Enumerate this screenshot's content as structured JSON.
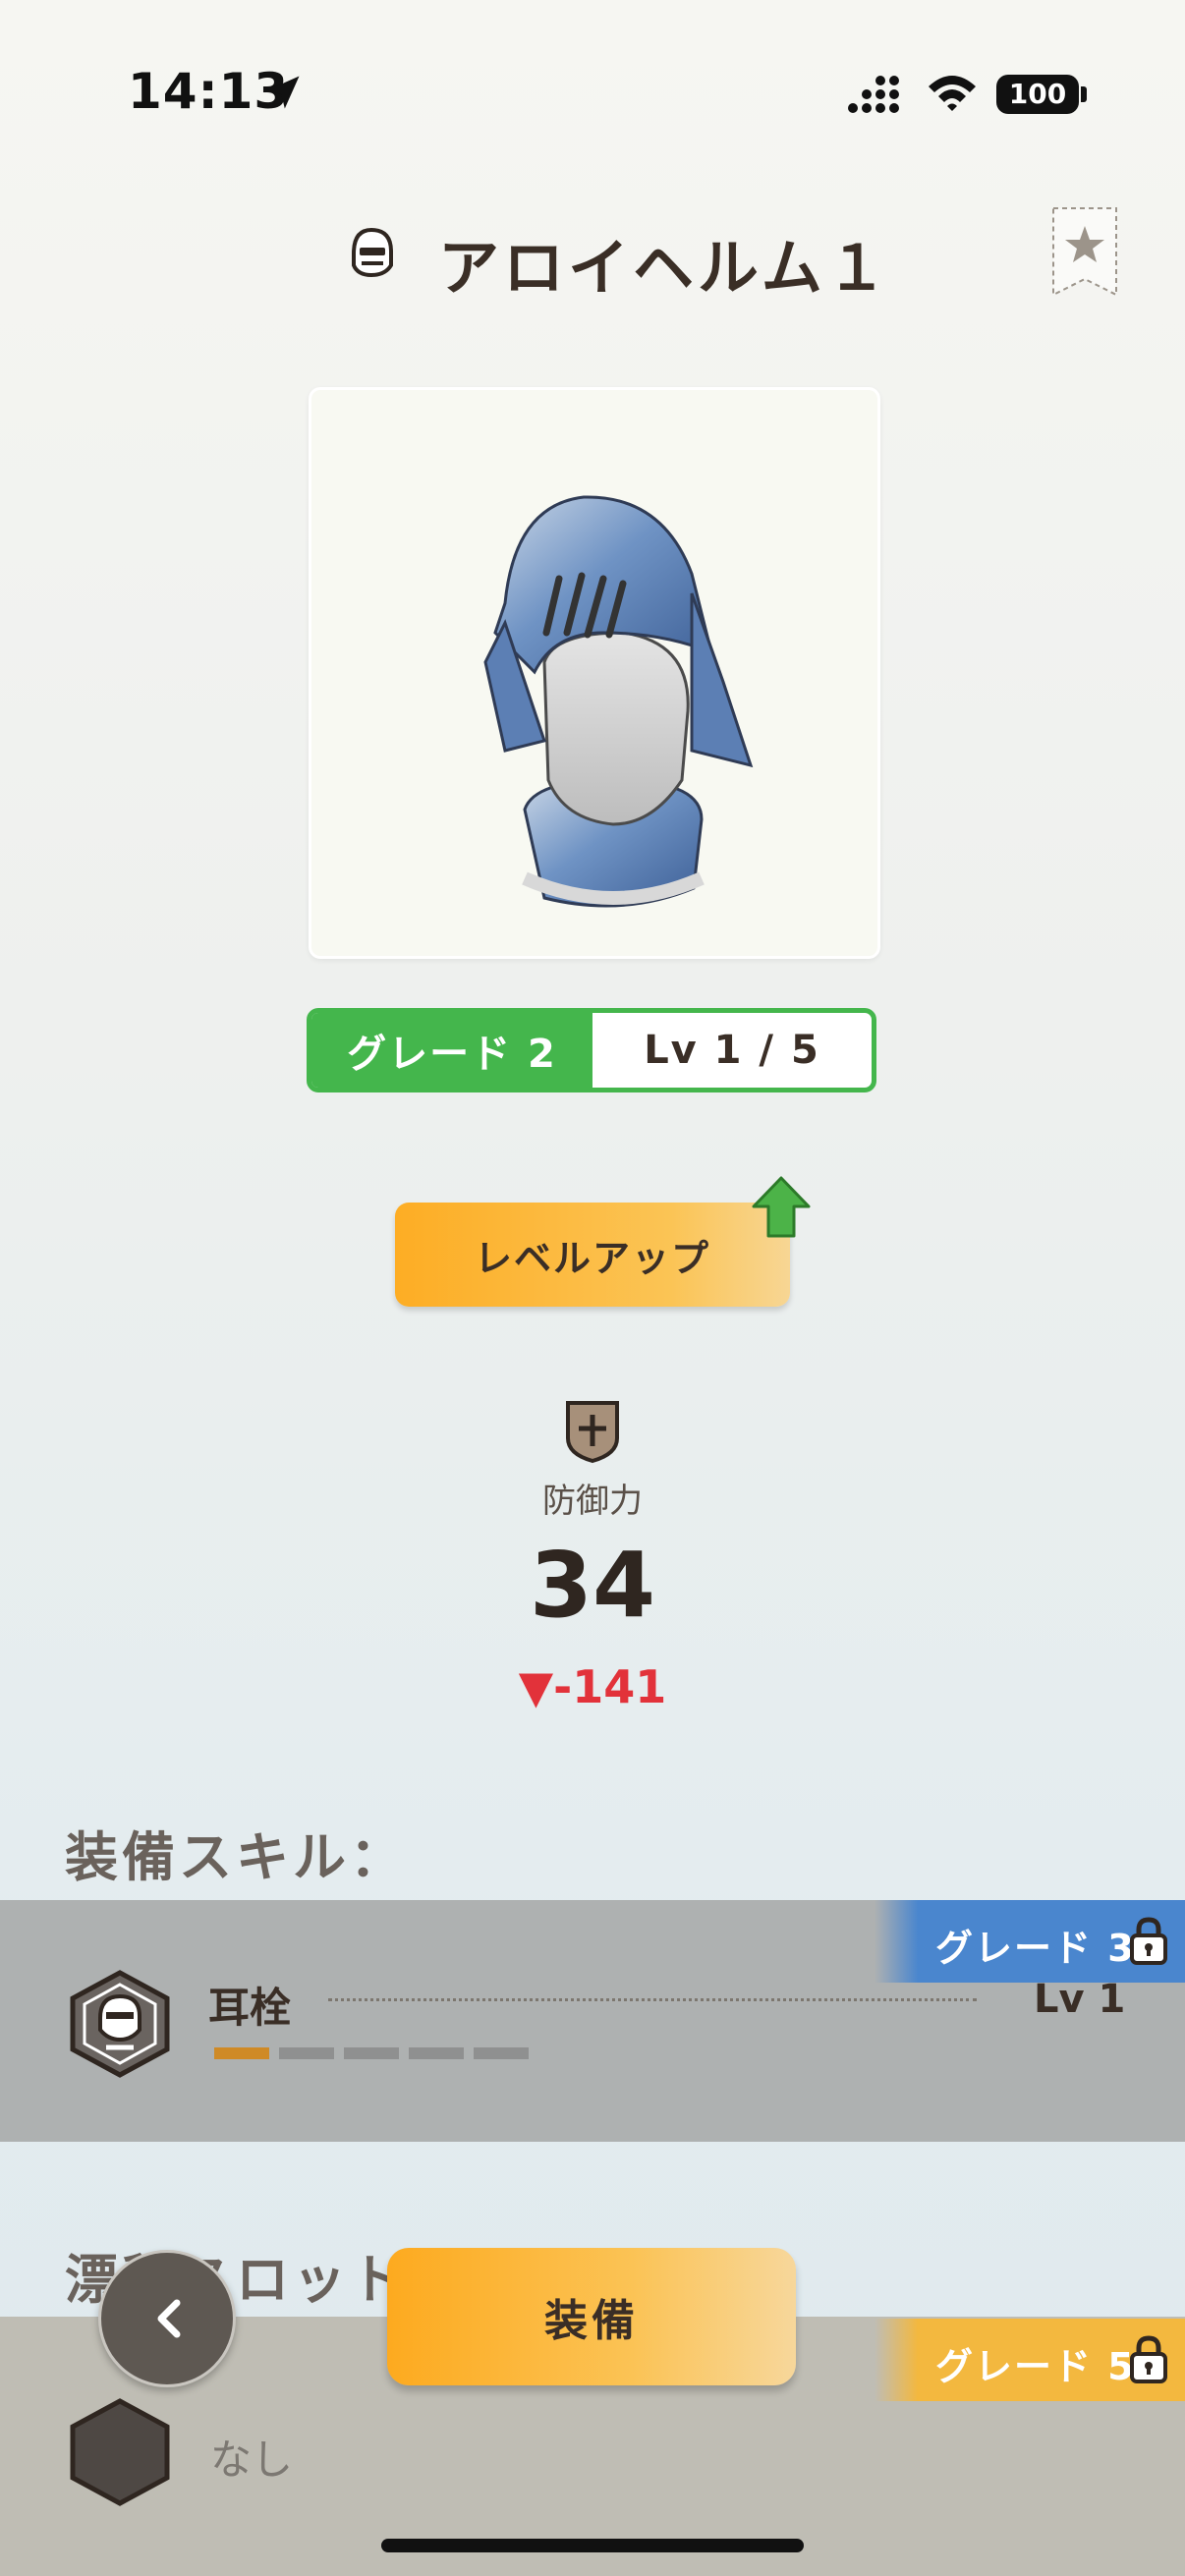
{
  "status_bar": {
    "time": "14:13",
    "battery": "100",
    "icons": [
      "location-arrow-icon",
      "signal-icon",
      "wifi-icon",
      "battery-icon"
    ]
  },
  "header": {
    "title": "アロイヘルム１",
    "icons": [
      "helmet-icon",
      "favorite-star-icon"
    ]
  },
  "item": {
    "image": "helmet-image",
    "grade": "グレード 2",
    "level": "Lv 1 / 5",
    "level_up_button": "レベルアップ"
  },
  "stats": {
    "defense_label": "防御力",
    "defense_value": "34",
    "defense_diff": "▼-141",
    "diff_color": "#e2323a"
  },
  "equip_skills": {
    "heading": "装備スキル：",
    "grade_tag": "グレード 3",
    "tag_color": "#4a86ce",
    "skill": {
      "name": "耳栓",
      "level": "Lv 1",
      "pips_total": 5,
      "pips_filled": 1
    }
  },
  "drift_slot": {
    "heading": "漂移スロット:",
    "grade_tag": "グレード 5",
    "tag_color": "#f3b83f",
    "value": "なし"
  },
  "actions": {
    "equip_button": "装備",
    "back_icon": "chevron-left-icon"
  },
  "colors": {
    "accent_orange": "#fdad24",
    "grade_green": "#44b64c",
    "text_brown": "#3a2e26"
  }
}
